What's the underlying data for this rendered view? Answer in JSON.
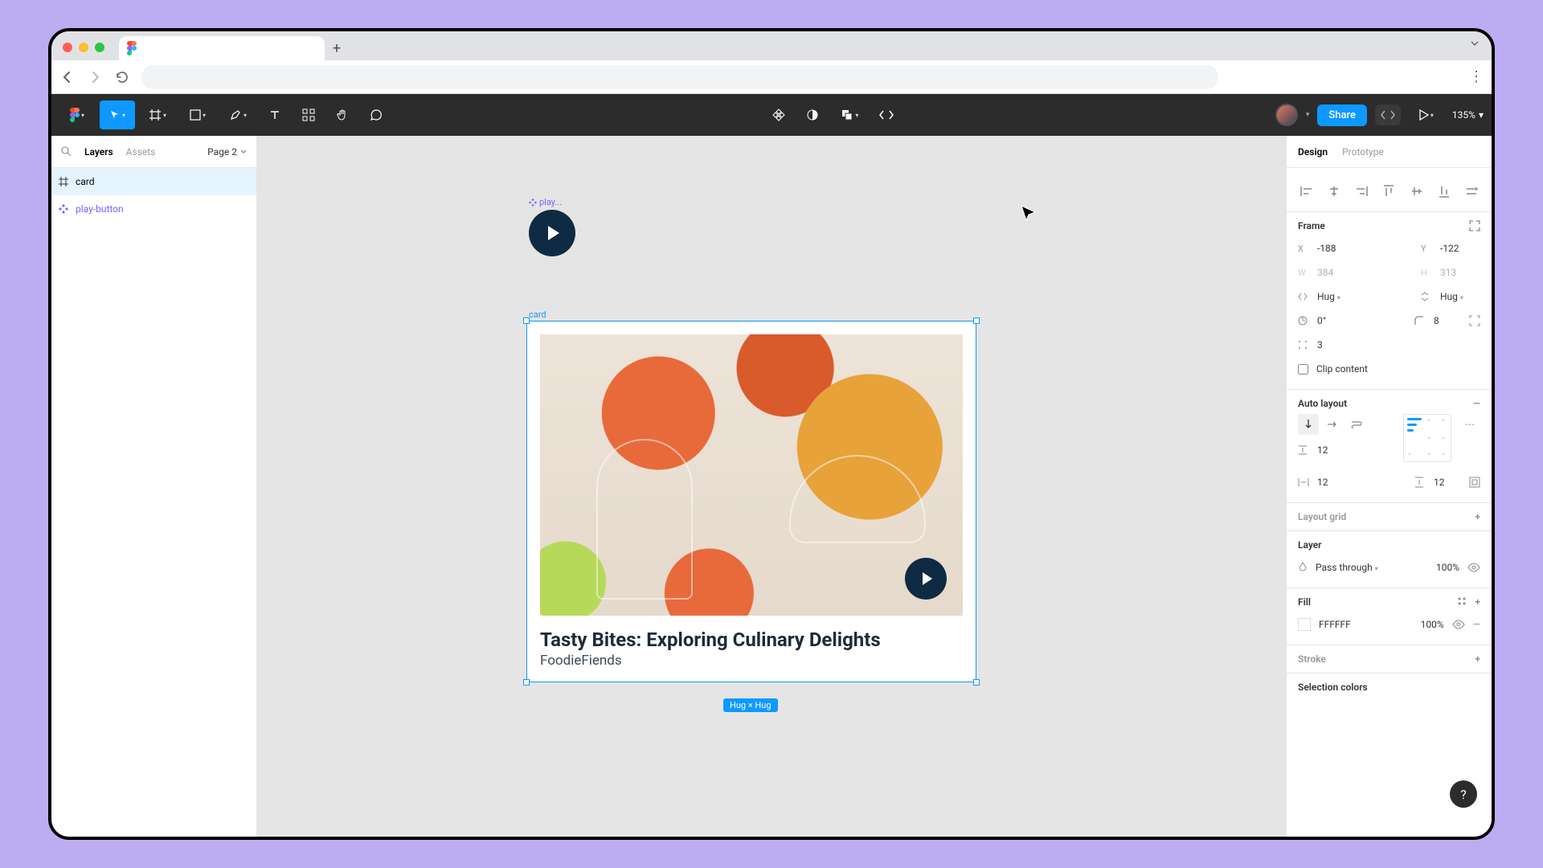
{
  "browser": {
    "newtab_glyph": "+"
  },
  "toolbar": {
    "share_label": "Share",
    "zoom": "135%"
  },
  "leftpanel": {
    "tabs": {
      "layers": "Layers",
      "assets": "Assets"
    },
    "page": "Page 2",
    "layers": [
      {
        "name": "card",
        "kind": "frame"
      },
      {
        "name": "play-button",
        "kind": "component"
      }
    ]
  },
  "canvas": {
    "play_component_label": "play...",
    "card_label": "card",
    "card": {
      "title": "Tasty Bites: Exploring Culinary Delights",
      "subtitle": "FoodieFiends"
    },
    "size_pill": "Hug × Hug"
  },
  "rightpanel": {
    "tabs": {
      "design": "Design",
      "prototype": "Prototype"
    },
    "frame": {
      "section": "Frame",
      "x_label": "X",
      "x": "-188",
      "y_label": "Y",
      "y": "-122",
      "w_label": "W",
      "w": "384",
      "h_label": "H",
      "h": "313",
      "hug_w": "Hug",
      "hug_h": "Hug",
      "rotation": "0°",
      "corner": "8",
      "spread": "3",
      "clip": "Clip content"
    },
    "autolayout": {
      "section": "Auto layout",
      "gap": "12",
      "pad_h": "12",
      "pad_v": "12"
    },
    "layout_grid": {
      "section": "Layout grid"
    },
    "layer": {
      "section": "Layer",
      "blend": "Pass through",
      "opacity": "100%"
    },
    "fill": {
      "section": "Fill",
      "hex": "FFFFFF",
      "opacity": "100%"
    },
    "stroke": {
      "section": "Stroke"
    },
    "selection_colors": {
      "section": "Selection colors"
    }
  },
  "help_glyph": "?"
}
